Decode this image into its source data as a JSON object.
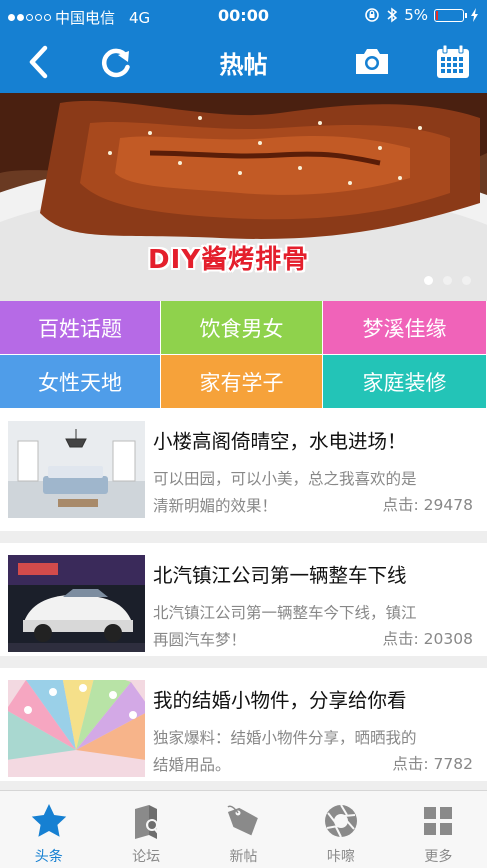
{
  "status_bar": {
    "carrier": "中国电信",
    "network": "4G",
    "time": "00:00",
    "battery": "5%",
    "battery_level": 0.05
  },
  "nav": {
    "title": "热帖",
    "back_icon": "chevron-left-icon",
    "refresh_icon": "refresh-icon",
    "camera_icon": "camera-icon",
    "calendar_icon": "calendar-icon"
  },
  "banner": {
    "caption": "DIY酱烤排骨",
    "slide_count": 3,
    "active_slide": 1
  },
  "categories": [
    {
      "label": "百姓话题",
      "color": "#b66ae6"
    },
    {
      "label": "饮食男女",
      "color": "#8fd24c"
    },
    {
      "label": "梦溪佳缘",
      "color": "#f063b9"
    },
    {
      "label": "女性天地",
      "color": "#4f9de9"
    },
    {
      "label": "家有学子",
      "color": "#f6a23a"
    },
    {
      "label": "家庭装修",
      "color": "#23c4b7"
    }
  ],
  "posts": [
    {
      "title": "小楼高阁倚晴空，水电进场！",
      "desc1": "可以田园，可以小美，总之我喜欢的是",
      "desc2": "清新明媚的效果！",
      "clicks": "点击: 29478"
    },
    {
      "title": "北汽镇江公司第一辆整车下线",
      "desc1": "北汽镇江公司第一辆整车今下线，镇江",
      "desc2": "再圆汽车梦！",
      "clicks": "点击: 20308"
    },
    {
      "title": "我的结婚小物件，分享给你看",
      "desc1": "独家爆料：结婚小物件分享，晒晒我的",
      "desc2": "结婚用品。",
      "clicks": "点击: 7782"
    }
  ],
  "tabs": [
    {
      "label": "头条",
      "icon": "star-icon",
      "active": true
    },
    {
      "label": "论坛",
      "icon": "forum-icon",
      "active": false
    },
    {
      "label": "新帖",
      "icon": "tag-icon",
      "active": false
    },
    {
      "label": "咔嚓",
      "icon": "aperture-icon",
      "active": false
    },
    {
      "label": "更多",
      "icon": "grid-icon",
      "active": false
    }
  ],
  "colors": {
    "primary": "#1680d2",
    "inactive": "#8a8a8a"
  }
}
